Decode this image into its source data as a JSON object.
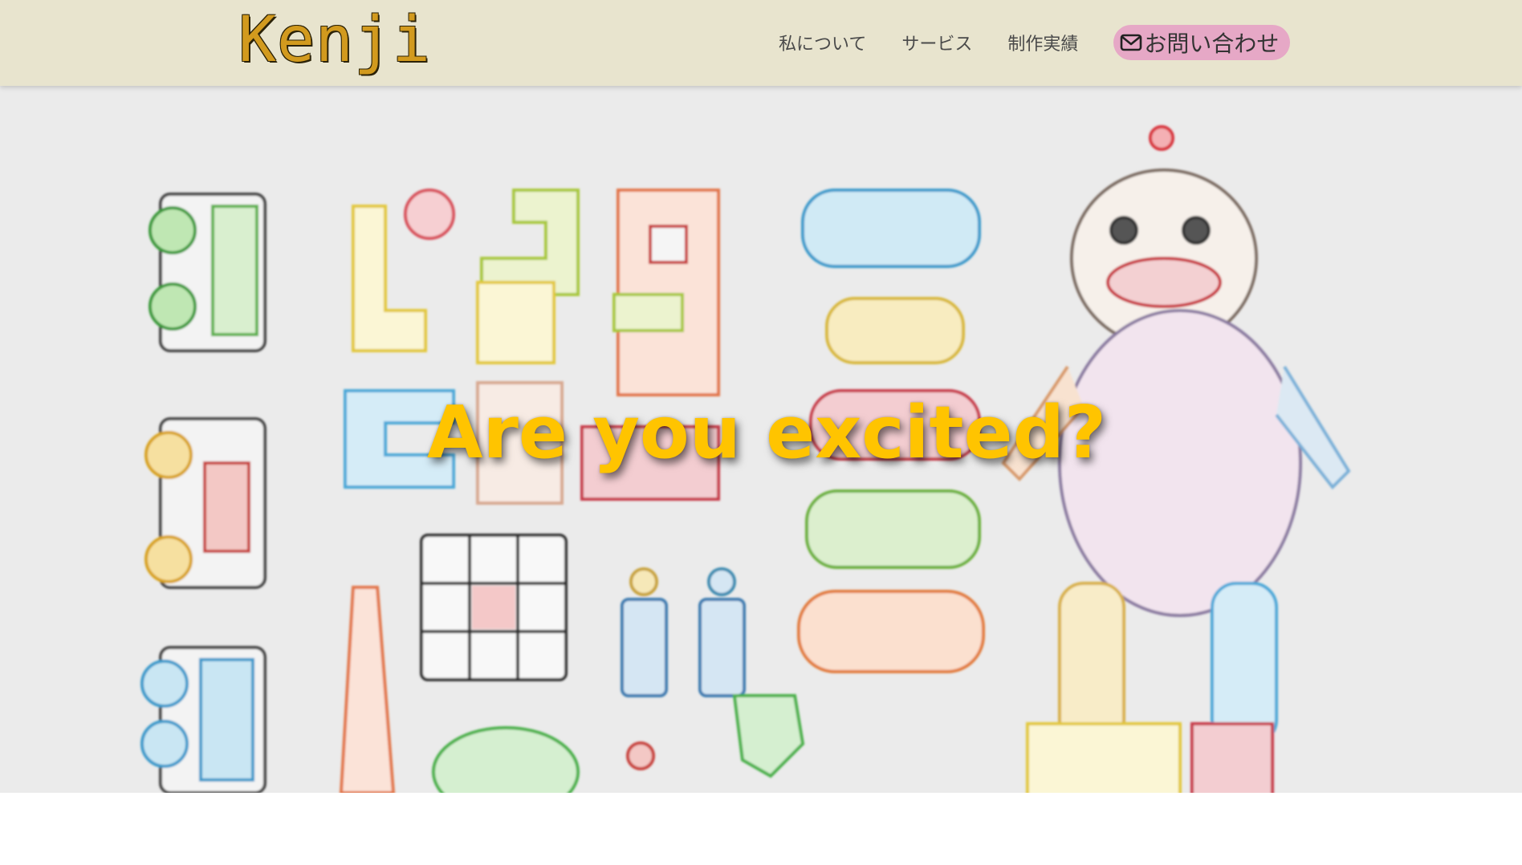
{
  "header": {
    "logo": "Kenji",
    "nav": [
      {
        "label": "私について"
      },
      {
        "label": "サービス"
      },
      {
        "label": "制作実績"
      }
    ],
    "contact_label": "お問い合わせ",
    "contact_icon": "envelope-icon",
    "colors": {
      "header_bg": "#e8e4ce",
      "logo": "#d29a1e",
      "contact_bg": "#e6a8c6"
    }
  },
  "hero": {
    "title": "Are you excited?",
    "title_color": "#ffc400",
    "background_image": "toy-collection-illustration"
  }
}
